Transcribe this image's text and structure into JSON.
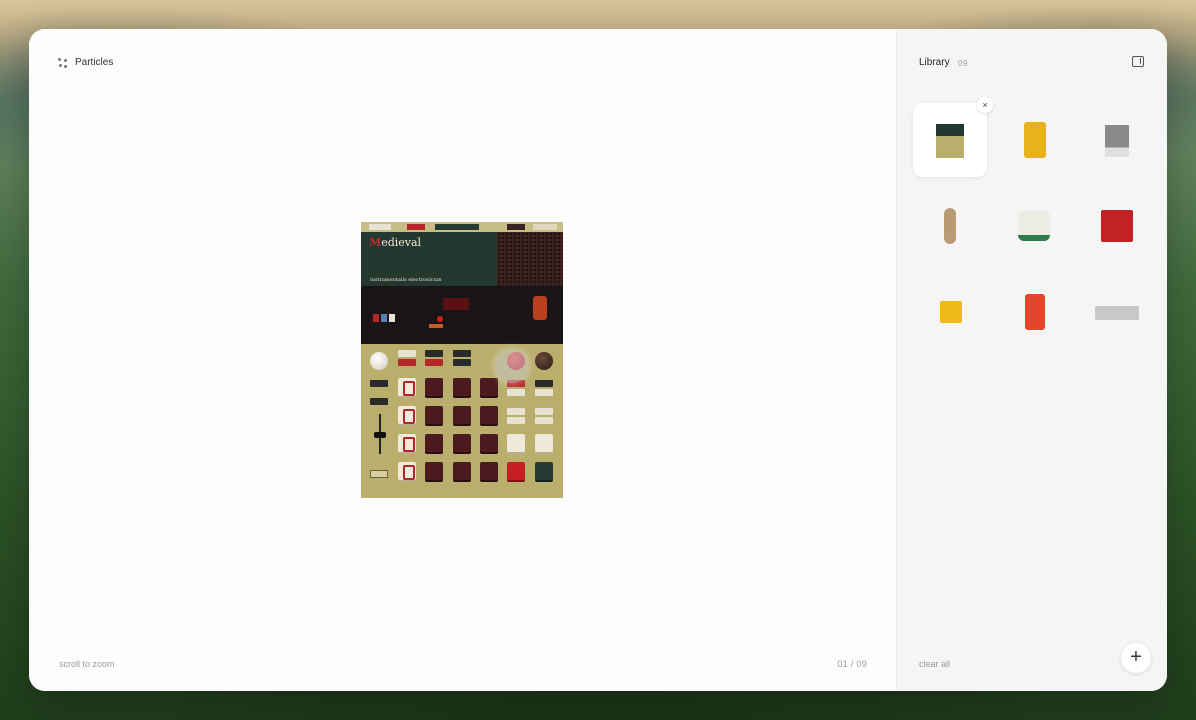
{
  "app": {
    "name": "Particles"
  },
  "main": {
    "hint": "scroll to zoom",
    "counter": "01 / 09"
  },
  "library": {
    "title": "Library",
    "count": "09",
    "remove_label": "×",
    "clear_label": "clear all",
    "add_label": "+",
    "items": [
      {
        "name": "medieval-synth",
        "selected": true
      },
      {
        "name": "yellow-pocket-device",
        "selected": false
      },
      {
        "name": "gray-speaker",
        "selected": false
      },
      {
        "name": "wooden-microphone",
        "selected": false
      },
      {
        "name": "white-radio",
        "selected": false
      },
      {
        "name": "red-boombox",
        "selected": false
      },
      {
        "name": "yellow-module",
        "selected": false
      },
      {
        "name": "red-suitcase",
        "selected": false
      },
      {
        "name": "gray-keyboard",
        "selected": false
      }
    ]
  },
  "device": {
    "title_initial": "M",
    "title_rest": "edieval",
    "subtitle": "instrumentalis electronicum"
  },
  "colors": {
    "accent_red": "#c51f25",
    "device_body": "#b9ae6c",
    "screen_green": "#23392f"
  },
  "icons": {
    "brand": "particles-icon",
    "panel": "panel-toggle-icon",
    "remove": "close-icon",
    "add": "plus-icon"
  }
}
